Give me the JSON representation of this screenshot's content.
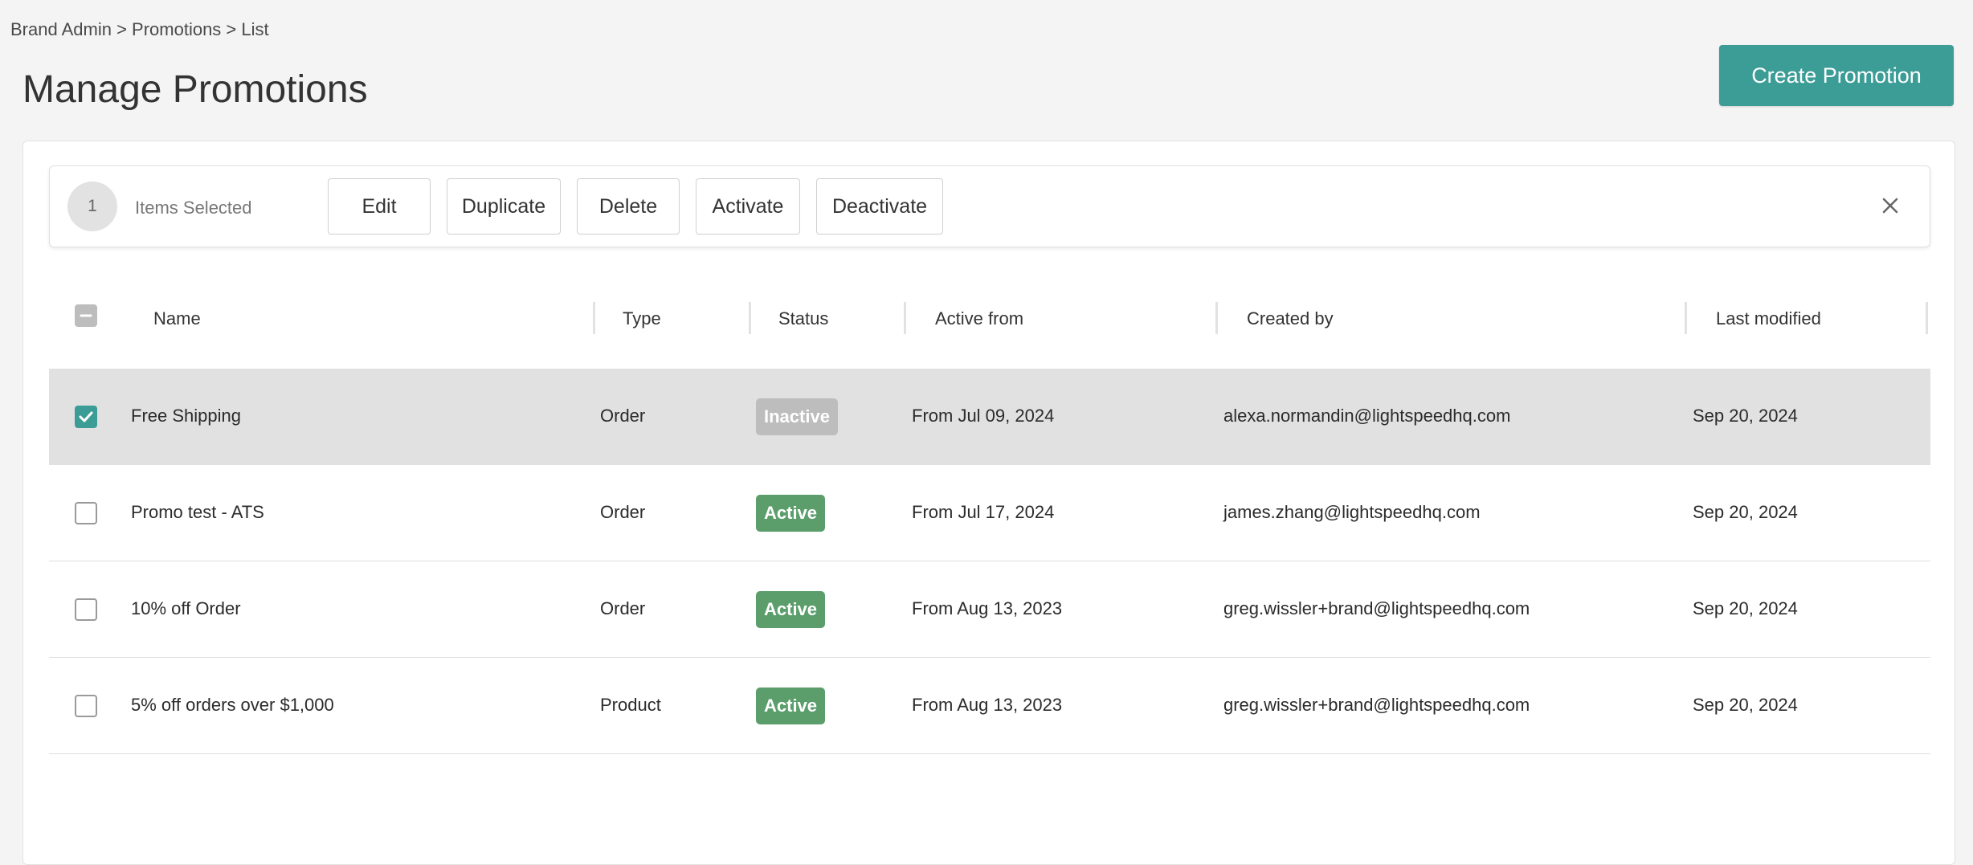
{
  "breadcrumb": "Brand Admin > Promotions > List",
  "page_title": "Manage Promotions",
  "create_button": "Create Promotion",
  "bulk_bar": {
    "count": "1",
    "items_label": "Items Selected",
    "actions": [
      "Edit",
      "Duplicate",
      "Delete",
      "Activate",
      "Deactivate"
    ],
    "close_icon": "close-icon"
  },
  "table": {
    "headers": [
      "Name",
      "Type",
      "Status",
      "Active from",
      "Created by",
      "Last modified"
    ],
    "rows": [
      {
        "name": "Free Shipping",
        "type": "Order",
        "status": "Inactive",
        "active_from": "From Jul 09, 2024",
        "created_by": "alexa.normandin@lightspeedhq.com",
        "last_modified": "Sep 20, 2024",
        "selected": true
      },
      {
        "name": "Promo test - ATS",
        "type": "Order",
        "status": "Active",
        "active_from": "From Jul 17, 2024",
        "created_by": "james.zhang@lightspeedhq.com",
        "last_modified": "Sep 20, 2024",
        "selected": false
      },
      {
        "name": "10% off Order",
        "type": "Order",
        "status": "Active",
        "active_from": "From Aug 13, 2023",
        "created_by": "greg.wissler+brand@lightspeedhq.com",
        "last_modified": "Sep 20, 2024",
        "selected": false
      },
      {
        "name": "5% off orders over $1,000",
        "type": "Product",
        "status": "Active",
        "active_from": "From Aug 13, 2023",
        "created_by": "greg.wissler+brand@lightspeedhq.com",
        "last_modified": "Sep 20, 2024",
        "selected": false
      }
    ]
  },
  "colors": {
    "accent": "#3c9d97",
    "active_badge": "#5b9e6b",
    "inactive_badge": "#bdbdbd",
    "selected_row": "#e1e1e1"
  }
}
